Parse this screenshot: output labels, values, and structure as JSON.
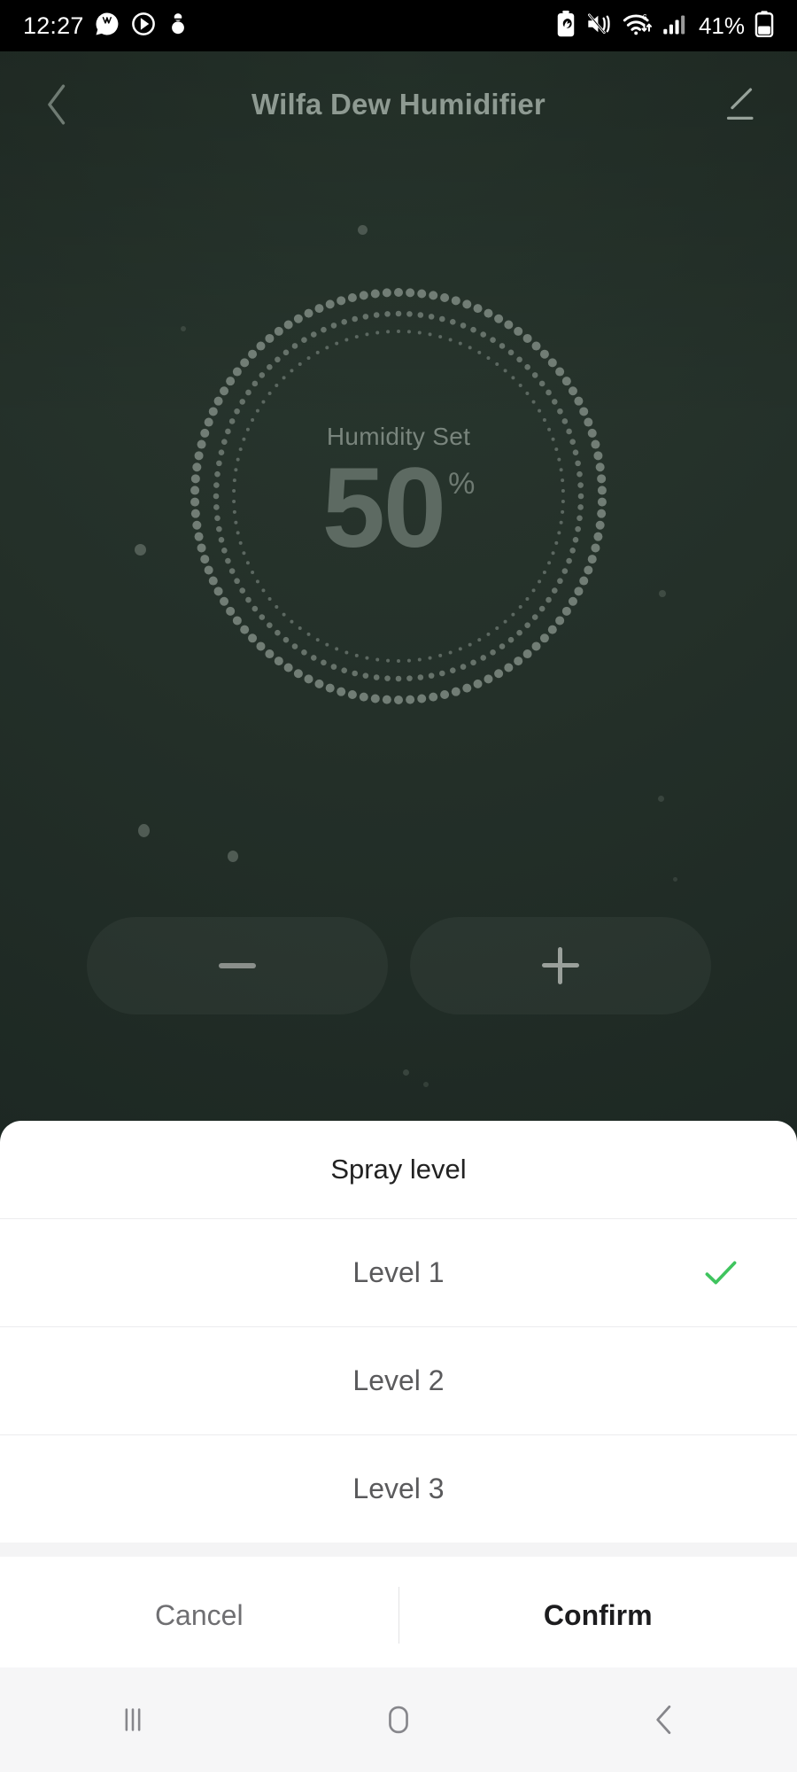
{
  "status_bar": {
    "time": "12:27",
    "left_icons": [
      "whatsapp-icon",
      "media-circle-icon",
      "snowman-icon"
    ],
    "right_icons": [
      "battery-saver-icon",
      "mute-vibrate-icon",
      "wifi-6-icon",
      "cellular-signal-icon"
    ],
    "battery_percent": "41%",
    "battery_icon": "battery-icon"
  },
  "header": {
    "back_icon": "back-chevron-icon",
    "title": "Wilfa Dew Humidifier",
    "edit_icon": "edit-pencil-icon"
  },
  "dial": {
    "label": "Humidity Set",
    "value": "50",
    "unit": "%"
  },
  "stepper": {
    "decrease_icon": "minus-icon",
    "increase_icon": "plus-icon"
  },
  "sheet": {
    "title": "Spray level",
    "options": [
      {
        "label": "Level 1",
        "selected": true
      },
      {
        "label": "Level 2",
        "selected": false
      },
      {
        "label": "Level 3",
        "selected": false
      }
    ],
    "check_icon": "check-icon",
    "cancel_label": "Cancel",
    "confirm_label": "Confirm"
  },
  "nav_bar": {
    "recents_icon": "recents-icon",
    "home_icon": "home-icon",
    "back_icon": "back-icon"
  },
  "colors": {
    "accent_green": "#3FC45E",
    "app_bg_top": "#2A3930",
    "app_bg_bottom": "#1D2823",
    "sheet_bg": "#FFFFFF",
    "nav_bg": "#F6F6F7"
  }
}
